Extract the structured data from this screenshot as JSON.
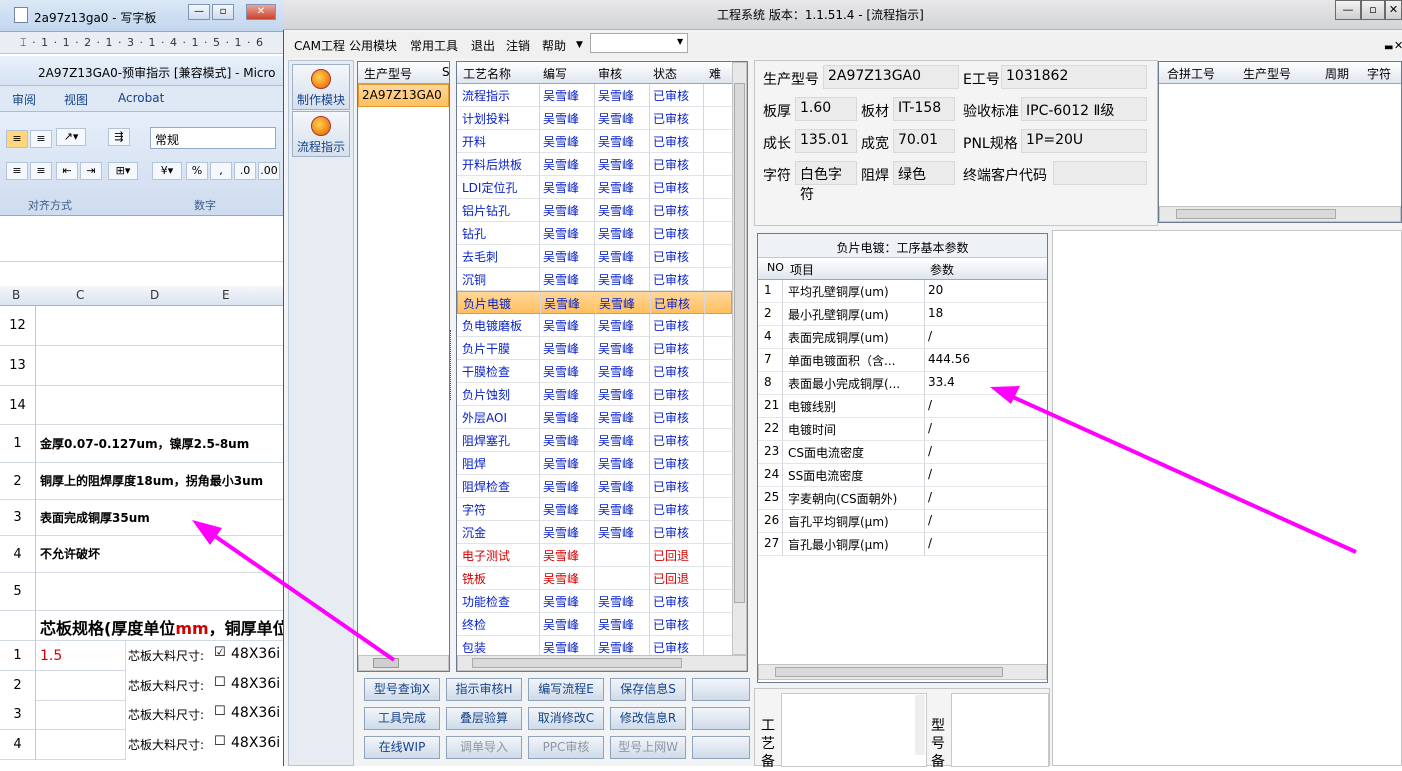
{
  "wordpad": {
    "title": "2a97z13ga0 - 写字板",
    "ruler": "⌶ · 1 · 1 · 2 · 1 · 3 · 1 · 4 · 1 · 5 · 1 · 6"
  },
  "excel": {
    "title": "2A97Z13GA0-预审指示  [兼容模式] - Micro",
    "tabs": [
      "审阅",
      "视图",
      "Acrobat"
    ],
    "number_format": "常规",
    "groups": [
      "对齐方式",
      "数字"
    ],
    "columns": [
      "B",
      "C",
      "D",
      "E"
    ],
    "rows": [
      {
        "num": "12",
        "text": ""
      },
      {
        "num": "13",
        "text": ""
      },
      {
        "num": "14",
        "text": ""
      },
      {
        "num": "1",
        "text": "金厚0.07-0.127um，镍厚2.5-8um"
      },
      {
        "num": "2",
        "text": "铜厚上的阻焊厚度18um，拐角最小3um"
      },
      {
        "num": "3",
        "text": "表面完成铜厚35um"
      },
      {
        "num": "4",
        "text": "不允许破坏"
      },
      {
        "num": "5",
        "text": ""
      }
    ],
    "core_header_a": "芯板规格(厚度单位",
    "core_header_mm": "mm",
    "core_header_b": "，铜厚单位",
    "core_rows": [
      {
        "num": "1",
        "val": "1.5",
        "label": "芯板大料尺寸:",
        "check": "☑",
        "size": "48X36i"
      },
      {
        "num": "2",
        "val": "",
        "label": "芯板大料尺寸:",
        "check": "☐",
        "size": "48X36i"
      },
      {
        "num": "3",
        "val": "",
        "label": "芯板大料尺寸:",
        "check": "☐",
        "size": "48X36i"
      },
      {
        "num": "4",
        "val": "",
        "label": "芯板大料尺寸:",
        "check": "☐",
        "size": "48X36i"
      }
    ]
  },
  "app": {
    "title": "工程系统  版本：1.1.51.4 - [流程指示]",
    "menu": [
      "CAM工程",
      "公用模块",
      "常用工具",
      "退出",
      "注销",
      "帮助"
    ],
    "side_buttons": [
      "制作模块",
      "流程指示"
    ],
    "model_grid": {
      "header": "生产型号",
      "header2": "S",
      "items": [
        "2A97Z13GA0"
      ]
    },
    "process_grid": {
      "headers": [
        "工艺名称",
        "编写",
        "审核",
        "状态",
        "难"
      ],
      "rows": [
        {
          "name": "流程指示",
          "writer": "吴雪峰",
          "reviewer": "吴雪峰",
          "status": "已审核"
        },
        {
          "name": "计划投料",
          "writer": "吴雪峰",
          "reviewer": "吴雪峰",
          "status": "已审核"
        },
        {
          "name": "开料",
          "writer": "吴雪峰",
          "reviewer": "吴雪峰",
          "status": "已审核"
        },
        {
          "name": "开料后烘板",
          "writer": "吴雪峰",
          "reviewer": "吴雪峰",
          "status": "已审核"
        },
        {
          "name": "LDI定位孔",
          "writer": "吴雪峰",
          "reviewer": "吴雪峰",
          "status": "已审核"
        },
        {
          "name": "铝片钻孔",
          "writer": "吴雪峰",
          "reviewer": "吴雪峰",
          "status": "已审核"
        },
        {
          "name": "钻孔",
          "writer": "吴雪峰",
          "reviewer": "吴雪峰",
          "status": "已审核"
        },
        {
          "name": "去毛刺",
          "writer": "吴雪峰",
          "reviewer": "吴雪峰",
          "status": "已审核"
        },
        {
          "name": "沉铜",
          "writer": "吴雪峰",
          "reviewer": "吴雪峰",
          "status": "已审核"
        },
        {
          "name": "负片电镀",
          "writer": "吴雪峰",
          "reviewer": "吴雪峰",
          "status": "已审核"
        },
        {
          "name": "负电镀磨板",
          "writer": "吴雪峰",
          "reviewer": "吴雪峰",
          "status": "已审核"
        },
        {
          "name": "负片干膜",
          "writer": "吴雪峰",
          "reviewer": "吴雪峰",
          "status": "已审核"
        },
        {
          "name": "干膜检查",
          "writer": "吴雪峰",
          "reviewer": "吴雪峰",
          "status": "已审核"
        },
        {
          "name": "负片蚀刻",
          "writer": "吴雪峰",
          "reviewer": "吴雪峰",
          "status": "已审核"
        },
        {
          "name": "外层AOI",
          "writer": "吴雪峰",
          "reviewer": "吴雪峰",
          "status": "已审核"
        },
        {
          "name": "阻焊塞孔",
          "writer": "吴雪峰",
          "reviewer": "吴雪峰",
          "status": "已审核"
        },
        {
          "name": "阻焊",
          "writer": "吴雪峰",
          "reviewer": "吴雪峰",
          "status": "已审核"
        },
        {
          "name": "阻焊检查",
          "writer": "吴雪峰",
          "reviewer": "吴雪峰",
          "status": "已审核"
        },
        {
          "name": "字符",
          "writer": "吴雪峰",
          "reviewer": "吴雪峰",
          "status": "已审核"
        },
        {
          "name": "沉金",
          "writer": "吴雪峰",
          "reviewer": "吴雪峰",
          "status": "已审核"
        },
        {
          "name": "电子测试",
          "writer": "吴雪峰",
          "reviewer": "",
          "status": "已回退"
        },
        {
          "name": "铣板",
          "writer": "吴雪峰",
          "reviewer": "",
          "status": "已回退"
        },
        {
          "name": "功能检查",
          "writer": "吴雪峰",
          "reviewer": "吴雪峰",
          "status": "已审核"
        },
        {
          "name": "终检",
          "writer": "吴雪峰",
          "reviewer": "吴雪峰",
          "status": "已审核"
        },
        {
          "name": "包装",
          "writer": "吴雪峰",
          "reviewer": "吴雪峰",
          "status": "已审核"
        }
      ]
    },
    "buttons_row1": [
      "型号查询X",
      "指示审核H",
      "编写流程E",
      "保存信息S",
      ""
    ],
    "buttons_row2": [
      "工具完成",
      "叠层验算",
      "取消修改C",
      "修改信息R",
      ""
    ],
    "buttons_row3": [
      "在线WIP",
      "调单导入",
      "PPC审核",
      "型号上网W",
      ""
    ],
    "info": {
      "model_label": "生产型号",
      "model_value": "2A97Z13GA0",
      "eng_label": "E工号",
      "eng_value": "1031862",
      "thick_label": "板厚",
      "thick_value": "1.60",
      "material_label": "板材",
      "material_value": "IT-158",
      "standard_label": "验收标准",
      "standard_value": "IPC-6012 Ⅱ级",
      "len_label": "成长",
      "len_value": "135.01",
      "width_label": "成宽",
      "width_value": "70.01",
      "pnl_label": "PNL规格",
      "pnl_value": "1P=20U",
      "char_label": "字符",
      "char_value": "白色字符",
      "mask_label": "阻焊",
      "mask_value": "绿色",
      "customer_label": "终端客户代码",
      "customer_value": ""
    },
    "merge_grid": {
      "headers": [
        "合拼工号",
        "生产型号",
        "周期",
        "字符"
      ]
    },
    "param_grid": {
      "title": "负片电镀：工序基本参数",
      "headers": [
        "NO",
        "项目",
        "参数"
      ],
      "rows": [
        {
          "no": "1",
          "item": "平均孔壁铜厚(um)",
          "value": "20"
        },
        {
          "no": "2",
          "item": "最小孔壁铜厚(um)",
          "value": "18"
        },
        {
          "no": "4",
          "item": "表面完成铜厚(um)",
          "value": "/"
        },
        {
          "no": "7",
          "item": "单面电镀面积（含...",
          "value": "444.56"
        },
        {
          "no": "8",
          "item": "表面最小完成铜厚(...",
          "value": "33.4"
        },
        {
          "no": "21",
          "item": "电镀线别",
          "value": "/"
        },
        {
          "no": "22",
          "item": "电镀时间",
          "value": "/"
        },
        {
          "no": "23",
          "item": "CS面电流密度",
          "value": "/"
        },
        {
          "no": "24",
          "item": "SS面电流密度",
          "value": "/"
        },
        {
          "no": "25",
          "item": "字麦朝向(CS面朝外)",
          "value": "/"
        },
        {
          "no": "26",
          "item": "盲孔平均铜厚(μm)",
          "value": "/"
        },
        {
          "no": "27",
          "item": "盲孔最小铜厚(μm)",
          "value": "/"
        }
      ]
    },
    "bottom_labels": {
      "process_desc": "工艺备",
      "model_desc": "型号备"
    }
  },
  "annotation_color": "#ff00ff"
}
